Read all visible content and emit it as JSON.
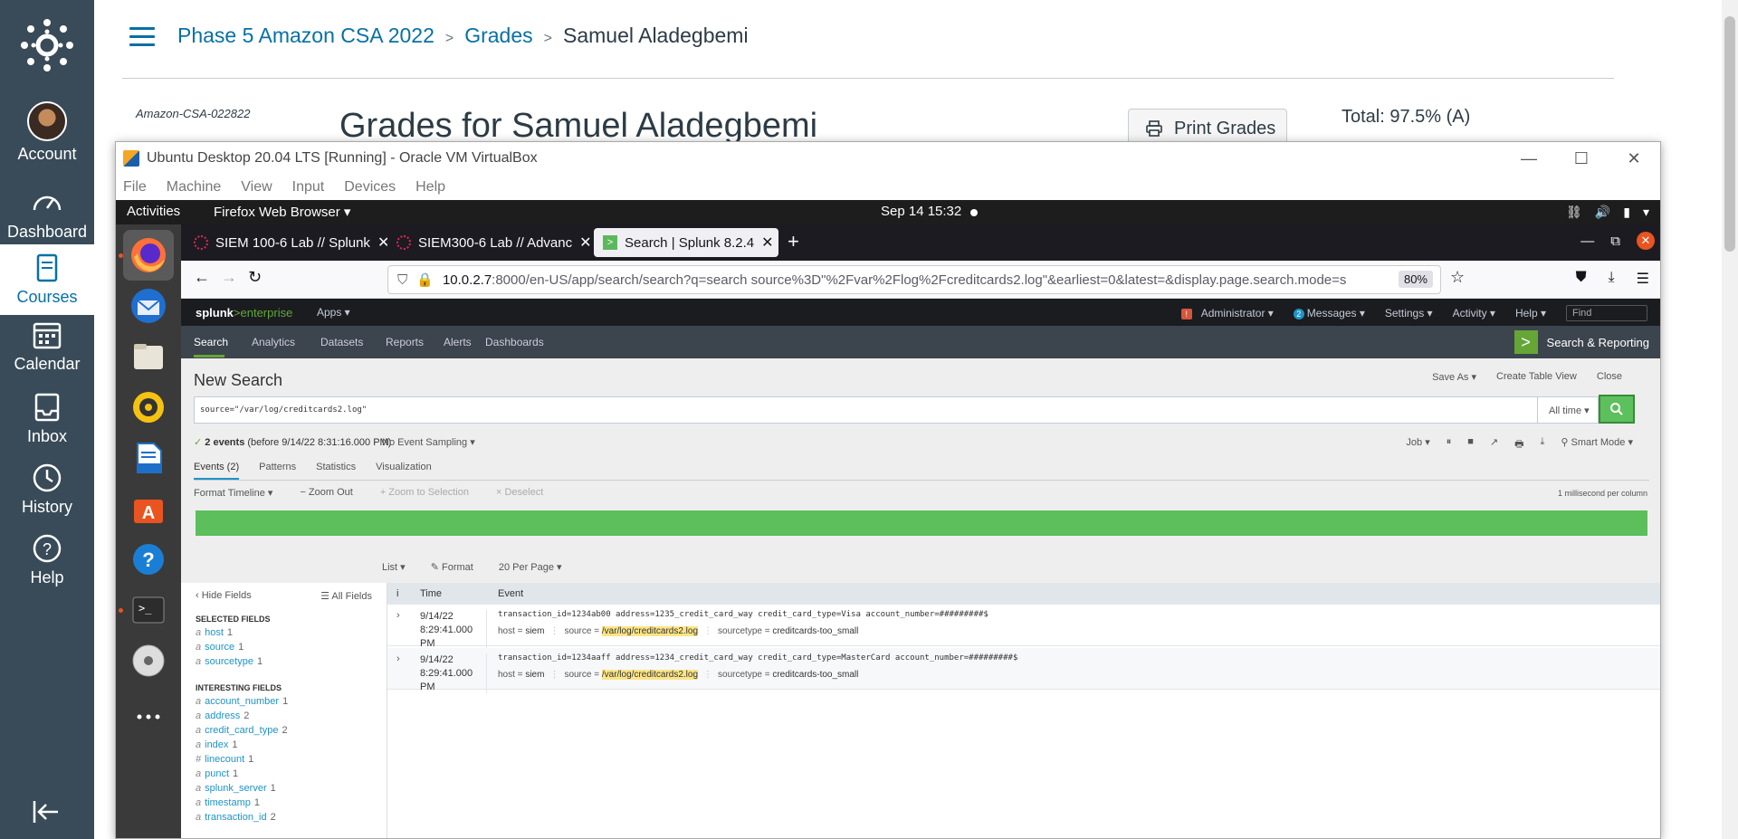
{
  "canvas_nav": {
    "items": [
      {
        "label": "Account",
        "icon": "avatar"
      },
      {
        "label": "Dashboard",
        "icon": "speedometer-icon"
      },
      {
        "label": "Courses",
        "icon": "book-icon"
      },
      {
        "label": "Calendar",
        "icon": "calendar-icon"
      },
      {
        "label": "Inbox",
        "icon": "inbox-icon"
      },
      {
        "label": "History",
        "icon": "clock-icon"
      },
      {
        "label": "Help",
        "icon": "question-icon"
      }
    ],
    "brand_color": "#394b58",
    "link_color": "#0770a3"
  },
  "breadcrumb": {
    "course": "Phase 5 Amazon CSA 2022",
    "section": "Grades",
    "current": "Samuel Aladegbemi",
    "separator": ">"
  },
  "grades": {
    "course_code": "Amazon-CSA-022822",
    "title": "Grades for Samuel Aladegbemi",
    "print_label": "Print Grades",
    "total": "Total: 97.5% (A)"
  },
  "vbox": {
    "title": "Ubuntu Desktop 20.04 LTS [Running] - Oracle VM VirtualBox",
    "menu": [
      "File",
      "Machine",
      "View",
      "Input",
      "Devices",
      "Help"
    ]
  },
  "ubuntu": {
    "activities": "Activities",
    "app_name": "Firefox Web Browser",
    "clock": "Sep 14  15:32"
  },
  "firefox": {
    "tabs": [
      {
        "title": "SIEM 100-6 Lab // Splunk",
        "active": false
      },
      {
        "title": "SIEM300-6 Lab // Advanc",
        "active": false
      },
      {
        "title": "Search | Splunk 8.2.4",
        "active": true
      }
    ],
    "url_host": "10.0.2.7",
    "url_rest": ":8000/en-US/app/search/search?q=search source%3D\"%2Fvar%2Flog%2Fcreditcards2.log\"&earliest=0&latest=&display.page.search.mode=s",
    "zoom": "80%"
  },
  "splunk": {
    "logo_main": "splunk",
    "logo_sub": ">enterprise",
    "apps": "Apps ▾",
    "topright": {
      "admin": "Administrator ▾",
      "messages": "Messages ▾",
      "messages_count": "2",
      "settings": "Settings ▾",
      "activity": "Activity ▾",
      "help": "Help ▾",
      "find": "Find"
    },
    "appnav": [
      "Search",
      "Analytics",
      "Datasets",
      "Reports",
      "Alerts",
      "Dashboards"
    ],
    "app_title": "Search & Reporting",
    "page_title": "New Search",
    "actions": [
      "Save As ▾",
      "Create Table View",
      "Close"
    ],
    "query": "source=\"/var/log/creditcards2.log\"",
    "time_range": "All time ▾",
    "status_count": "2 events",
    "status_rest": "(before 9/14/22 8:31:16.000 PM)",
    "sampling": "No Event Sampling ▾",
    "job_controls": [
      "Job ▾",
      "⏸",
      "■",
      "↗",
      "🖶",
      "⤓",
      "⚲ Smart Mode ▾"
    ],
    "result_tabs": [
      "Events (2)",
      "Patterns",
      "Statistics",
      "Visualization"
    ],
    "timeline": {
      "format": "Format Timeline ▾",
      "zoom_out": "− Zoom Out",
      "zoom_sel": "+ Zoom to Selection",
      "deselect": "× Deselect",
      "scale": "1 millisecond per column"
    },
    "results_bar": [
      "List ▾",
      "✎ Format",
      "20 Per Page ▾"
    ],
    "fields_panel": {
      "hide": "‹ Hide Fields",
      "all": "☰ All Fields",
      "selected_title": "SELECTED FIELDS",
      "selected": [
        {
          "type": "a",
          "name": "host",
          "count": "1"
        },
        {
          "type": "a",
          "name": "source",
          "count": "1"
        },
        {
          "type": "a",
          "name": "sourcetype",
          "count": "1"
        }
      ],
      "interesting_title": "INTERESTING FIELDS",
      "interesting": [
        {
          "type": "a",
          "name": "account_number",
          "count": "1"
        },
        {
          "type": "a",
          "name": "address",
          "count": "2"
        },
        {
          "type": "a",
          "name": "credit_card_type",
          "count": "2"
        },
        {
          "type": "a",
          "name": "index",
          "count": "1"
        },
        {
          "type": "#",
          "name": "linecount",
          "count": "1"
        },
        {
          "type": "a",
          "name": "punct",
          "count": "1"
        },
        {
          "type": "a",
          "name": "splunk_server",
          "count": "1"
        },
        {
          "type": "a",
          "name": "timestamp",
          "count": "1"
        },
        {
          "type": "a",
          "name": "transaction_id",
          "count": "2"
        }
      ]
    },
    "events_head": {
      "i": "i",
      "time": "Time",
      "event": "Event"
    },
    "events": [
      {
        "date": "9/14/22",
        "time": "8:29:41.000 PM",
        "raw": "transaction_id=1234ab00 address=1235_credit_card_way credit_card_type=Visa account_number=#########$",
        "host": "siem",
        "source": "/var/log/creditcards2.log",
        "sourcetype": "creditcards-too_small"
      },
      {
        "date": "9/14/22",
        "time": "8:29:41.000 PM",
        "raw": "transaction_id=1234aaff address=1234_credit_card_way credit_card_type=MasterCard account_number=#########$",
        "host": "siem",
        "source": "/var/log/creditcards2.log",
        "sourcetype": "creditcards-too_small"
      }
    ],
    "accent_green": "#65a637"
  }
}
